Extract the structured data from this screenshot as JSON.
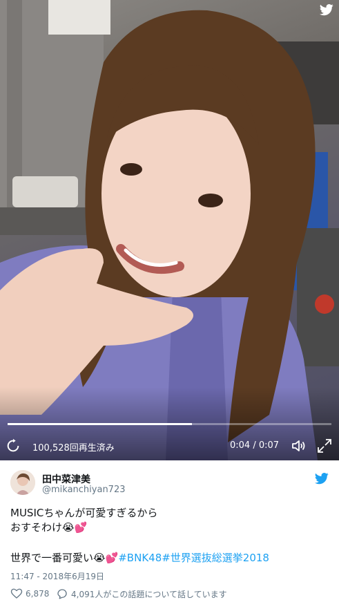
{
  "video": {
    "views_label": "100,528回再生済み",
    "time_current": "0:04",
    "time_separator": " / ",
    "time_total": "0:07",
    "progress_fraction": 0.57,
    "icons": [
      "twitter-bird-icon",
      "replay-icon",
      "volume-icon",
      "fullscreen-icon"
    ]
  },
  "tweet": {
    "display_name": "田中菜津美",
    "handle": "@mikanchiyan723",
    "line1": "MUSICちゃんが可愛すぎるから",
    "line2_text": "おすそわけ",
    "line2_emoji": "😭💕",
    "line3_text": "世界で一番可愛い",
    "line3_emoji": "😭💕",
    "line3_hashtags": "#BNK48#世界選抜総選挙2018",
    "timestamp": "11:47 - 2018年6月19日",
    "likes": "6,878",
    "replies_text": "4,091人がこの話題について話しています"
  },
  "colors": {
    "twitter_blue": "#1da1f2",
    "secondary_text": "#657786",
    "primary_text": "#14171a"
  }
}
